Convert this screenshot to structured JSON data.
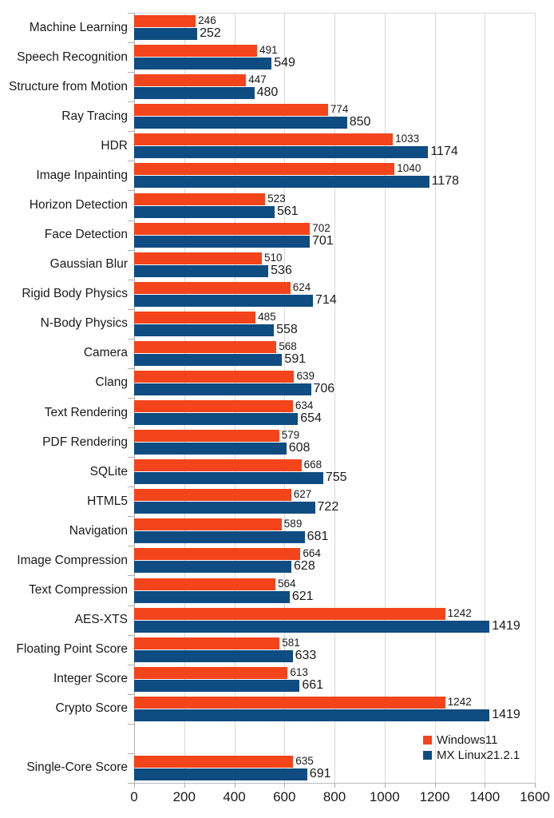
{
  "chart_data": {
    "type": "bar",
    "orientation": "horizontal",
    "title": "",
    "subtitle": "",
    "xlabel": "",
    "ylabel": "",
    "xlim": [
      0,
      1600
    ],
    "xticks": [
      0,
      200,
      400,
      600,
      800,
      1000,
      1200,
      1400,
      1600
    ],
    "xtick_labels": [
      "0",
      "200",
      "400",
      "600",
      "800",
      "1000",
      "1200",
      "1400",
      "1600"
    ],
    "grid": true,
    "legend_position": "bottom-right",
    "show_value_labels": true,
    "categories": [
      "Machine Learning",
      "Speech Recognition",
      "Structure from Motion",
      "Ray Tracing",
      "HDR",
      "Image Inpainting",
      "Horizon Detection",
      "Face Detection",
      "Gaussian Blur",
      "Rigid Body Physics",
      "N-Body Physics",
      "Camera",
      "Clang",
      "Text Rendering",
      "PDF Rendering",
      "SQLite",
      "HTML5",
      "Navigation",
      "Image Compression",
      "Text Compression",
      "AES-XTS",
      "Floating Point Score",
      "Integer Score",
      "Crypto Score",
      "",
      "Single-Core Score"
    ],
    "series": [
      {
        "name": "Windows11",
        "color": "#f4441b",
        "values": [
          246,
          491,
          447,
          774,
          1033,
          1040,
          523,
          702,
          510,
          624,
          485,
          568,
          639,
          634,
          579,
          668,
          627,
          589,
          664,
          564,
          1242,
          581,
          613,
          1242,
          null,
          635
        ]
      },
      {
        "name": "MX Linux21.2.1",
        "color": "#0f4c81",
        "values": [
          252,
          549,
          480,
          850,
          1174,
          1178,
          561,
          701,
          536,
          714,
          558,
          591,
          706,
          654,
          608,
          755,
          722,
          681,
          628,
          621,
          1419,
          633,
          661,
          1419,
          null,
          691
        ]
      }
    ]
  },
  "legend": {
    "entries": [
      {
        "label": "Windows11",
        "color": "#f4441b"
      },
      {
        "label": "MX Linux21.2.1",
        "color": "#0f4c81"
      }
    ]
  },
  "colors": {
    "series_windows": "#f4441b",
    "series_mxlinux": "#0f4c81",
    "grid": "#d9d9d9",
    "axis": "#b0b0b0",
    "text": "#1a1a1a",
    "background": "#ffffff"
  }
}
